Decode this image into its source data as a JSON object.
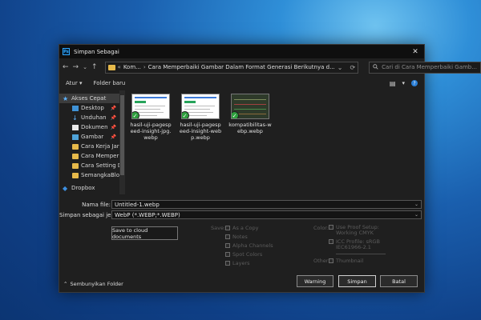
{
  "window": {
    "title": "Simpan Sebagai",
    "app_icon": "Ps",
    "close_glyph": "✕"
  },
  "nav": {
    "back": "←",
    "forward": "→",
    "dropdown": "⌄",
    "up": "↑",
    "address": {
      "prefix": "«",
      "seg1": "Kom...",
      "sep": "›",
      "seg2": "Cara Memperbaiki Gambar Dalam Format Generasi Berikutnya d...",
      "chevron": "⌄",
      "refresh": "⟳"
    },
    "search_placeholder": "Cari di Cara Memperbaiki Gamb..."
  },
  "toolbar": {
    "organize": "Atur ▾",
    "new_folder": "Folder baru",
    "view_glyph": "▤",
    "view_dd": "▾",
    "help_glyph": "?"
  },
  "sidebar": {
    "items": [
      {
        "label": "Akses Cepat",
        "icon": "star-icon"
      },
      {
        "label": "Desktop",
        "icon": "desktop-icon",
        "pin": "📌"
      },
      {
        "label": "Unduhan",
        "icon": "download-icon",
        "pin": "📌"
      },
      {
        "label": "Dokumen",
        "icon": "document-icon",
        "pin": "📌"
      },
      {
        "label": "Gambar",
        "icon": "pictures-icon",
        "pin": "📌"
      },
      {
        "label": "Cara Kerja Jaring",
        "icon": "folder-icon"
      },
      {
        "label": "Cara Memperba",
        "icon": "folder-icon"
      },
      {
        "label": "Cara Setting DH",
        "icon": "folder-icon"
      },
      {
        "label": "SemangkaBlog",
        "icon": "folder-icon"
      },
      {
        "label": "Dropbox",
        "icon": "dropbox-icon"
      }
    ]
  },
  "files": [
    {
      "name": "hasil-uji-pagespeed-insight-jpg.webp"
    },
    {
      "name": "hasil-uji-pagespeed-insight-webp.webp"
    },
    {
      "name": "kompatibilitas-webp.webp"
    }
  ],
  "form": {
    "filename_label": "Nama file:",
    "filename_value": "Untitled-1.webp",
    "type_label": "Simpan sebagai je...",
    "type_value": "WebP (*.WEBP;*.WEBP)",
    "dd_glyph": "⌄",
    "cloud_button": "Save to cloud documents",
    "save_label": "Save:",
    "save_options": [
      "As a Copy",
      "Notes",
      "Alpha Channels",
      "Spot Colors",
      "Layers"
    ],
    "color_label": "Color:",
    "color_options": [
      "Use Proof Setup: Working CMYK",
      "ICC Profile: sRGB IEC61966-2.1"
    ],
    "other_label": "Other:",
    "other_options": [
      "Thumbnail"
    ]
  },
  "footer": {
    "hide_folders": "Sembunyikan Folder",
    "hide_glyph": "⌃",
    "warning": "Warning",
    "save": "Simpan",
    "cancel": "Batal"
  }
}
